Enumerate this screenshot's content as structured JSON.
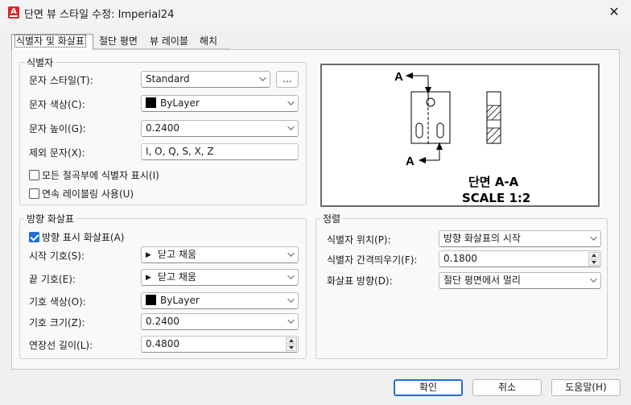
{
  "window": {
    "title": "단면 뷰 스타일 수정: Imperial24",
    "close_glyph": "✕",
    "app_icon": "A"
  },
  "tabs": [
    {
      "label": "식별자 및 화살표",
      "active": true
    },
    {
      "label": "절단 평면"
    },
    {
      "label": "뷰 레이블"
    },
    {
      "label": "해치"
    }
  ],
  "identifier_group": {
    "title": "식별자",
    "text_style": {
      "label": "문자 스타일(T):",
      "value": "Standard",
      "browse": "..."
    },
    "text_color": {
      "label": "문자 색상(C):",
      "value": "ByLayer",
      "swatch": "#000000"
    },
    "text_height": {
      "label": "문자 높이(G):",
      "value": "0.2400"
    },
    "exclude_chars": {
      "label": "제외 문자(X):",
      "value": "I, O, Q, S, X, Z"
    },
    "show_all_bends": {
      "label": "모든 절곡부에 식별자 표시(I)",
      "checked": false
    },
    "continuous_labeling": {
      "label": "연속 레이블링 사용(U)",
      "checked": false
    }
  },
  "arrow_group": {
    "title": "방향 화살표",
    "show_arrows": {
      "label": "방향 표시 화살표(A)",
      "checked": true
    },
    "start_symbol": {
      "label": "시작 기호(S):",
      "value": "닫고 채움",
      "glyph": "▶"
    },
    "end_symbol": {
      "label": "끝 기호(E):",
      "value": "닫고 채움",
      "glyph": "▶"
    },
    "symbol_color": {
      "label": "기호 색상(O):",
      "value": "ByLayer",
      "swatch": "#000000"
    },
    "symbol_size": {
      "label": "기호 크기(Z):",
      "value": "0.2400"
    },
    "extension_length": {
      "label": "연장선 길이(L):",
      "value": "0.4800"
    }
  },
  "alignment_group": {
    "title": "정렬",
    "identifier_position": {
      "label": "식별자 위치(P):",
      "value": "방향 화살표의 시작"
    },
    "identifier_offset": {
      "label": "식별자 간격띄우기(F):",
      "value": "0.1800"
    },
    "arrow_direction": {
      "label": "화살표 방향(D):",
      "value": "절단 평면에서 멀리"
    }
  },
  "preview": {
    "label_top": "A",
    "label_bottom": "A",
    "section_title": "단면 A-A",
    "scale_text": "SCALE 1:2"
  },
  "buttons": {
    "ok": "확인",
    "cancel": "취소",
    "help": "도움말(H)"
  }
}
